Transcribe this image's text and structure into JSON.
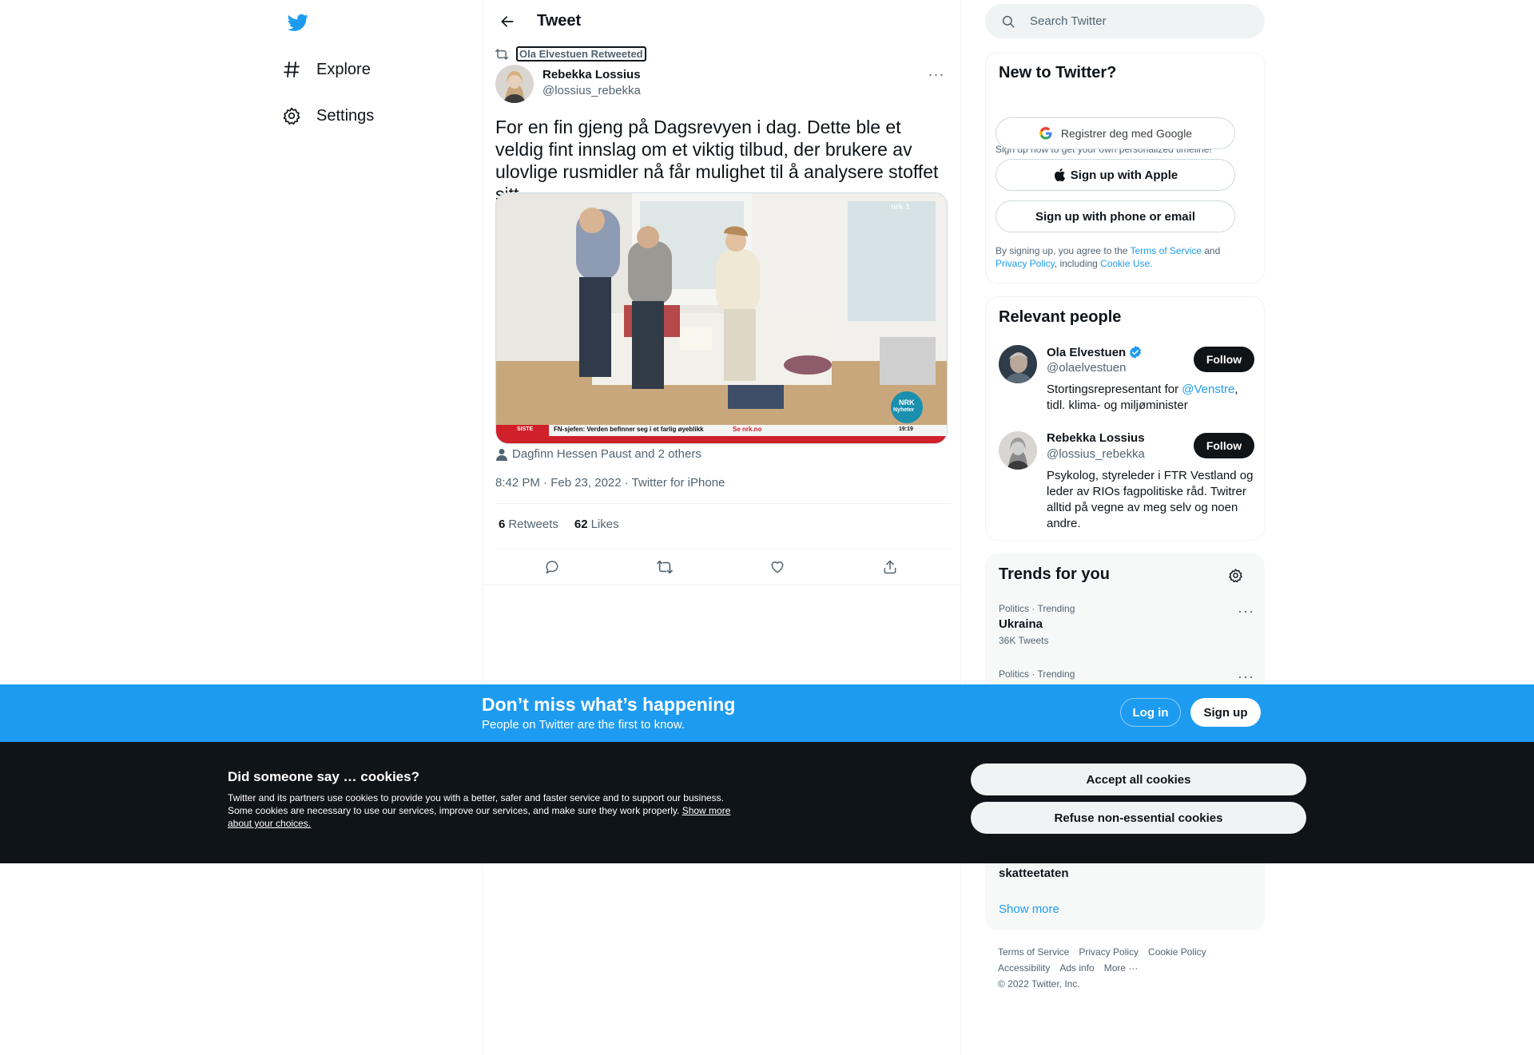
{
  "nav": {
    "items": [
      {
        "label": "Explore",
        "icon": "hashtag-icon"
      },
      {
        "label": "Settings",
        "icon": "gear-icon"
      }
    ]
  },
  "header": {
    "title": "Tweet"
  },
  "tweet": {
    "retweeted_by": "Ola Elvestuen Retweeted",
    "author_name": "Rebekka Lossius",
    "author_handle": "@lossius_rebekka",
    "text": "For en fin gjeng på Dagsrevyen i dag. Dette ble et veldig fint innslag om et viktig tilbud, der brukere av ulovlige rusmidler nå får mulighet til å analysere stoffet sitt.",
    "media": {
      "ticker_badge": "SISTE",
      "ticker_text": "FN-sjefen: Verden befinner seg i et farlig øyeblikk",
      "ticker_link": "Se nrk.no",
      "ticker_time": "19:19",
      "channel_logo": "nrk 1",
      "corner_logo_top": "NRK",
      "corner_logo_bottom": "Nyheter"
    },
    "tagged": "Dagfinn Hessen Paust and 2 others",
    "meta": "8:42 PM · Feb 23, 2022 · Twitter for iPhone",
    "retweets_count": "6",
    "retweets_label": "Retweets",
    "likes_count": "62",
    "likes_label": "Likes"
  },
  "search": {
    "placeholder": "Search Twitter"
  },
  "new_to_twitter": {
    "title": "New to Twitter?",
    "subtitle": "Sign up now to get your own personalized timeline!",
    "google_label": "Registrer deg med Google",
    "apple_label": "Sign up with Apple",
    "phone_label": "Sign up with phone or email",
    "terms_prefix": "By signing up, you agree to the ",
    "terms_link": "Terms of Service",
    "terms_and": " and",
    "privacy_link": "Privacy Policy",
    "terms_including": ", including ",
    "cookie_link": "Cookie Use."
  },
  "relevant_people": {
    "title": "Relevant people",
    "people": [
      {
        "name": "Ola Elvestuen",
        "handle": "@olaelvestuen",
        "bio_prefix": "Stortingsrepresentant for ",
        "bio_link": "@Venstre",
        "bio_suffix": ", tidl. klima- og miljøminister",
        "follow_label": "Follow"
      },
      {
        "name": "Rebekka Lossius",
        "handle": "@lossius_rebekka",
        "bio": "Psykolog, styreleder i FTR Vestland og leder av RIOs fagpolitiske råd. Twitrer alltid på vegne av meg selv og noen andre.",
        "follow_label": "Follow"
      }
    ]
  },
  "trends": {
    "title": "Trends for you",
    "items": [
      {
        "meta": "Politics · Trending",
        "name": "Ukraina",
        "count": "36K Tweets"
      },
      {
        "meta": "Politics · Trending",
        "name": "",
        "count": ""
      },
      {
        "meta": "",
        "name": "skatteetaten",
        "count": ""
      }
    ],
    "show_more": "Show more"
  },
  "footer": {
    "links": [
      "Terms of Service",
      "Privacy Policy",
      "Cookie Policy",
      "Accessibility",
      "Ads info",
      "More ···"
    ],
    "copyright": "© 2022 Twitter, Inc."
  },
  "banner": {
    "title": "Don’t miss what’s happening",
    "subtitle": "People on Twitter are the first to know.",
    "login_label": "Log in",
    "signup_label": "Sign up"
  },
  "cookies": {
    "title": "Did someone say … cookies?",
    "body": "Twitter and its partners use cookies to provide you with a better, safer and faster service and to support our business. Some cookies are necessary to use our services, improve our services, and make sure they work properly. ",
    "link": "Show more about your choices.",
    "accept_label": "Accept all cookies",
    "refuse_label": "Refuse non-essential cookies"
  },
  "colors": {
    "brand": "#1d9bf0",
    "text_primary": "#0f1419",
    "text_secondary": "#536471",
    "cookie_bg": "#0f1419"
  }
}
